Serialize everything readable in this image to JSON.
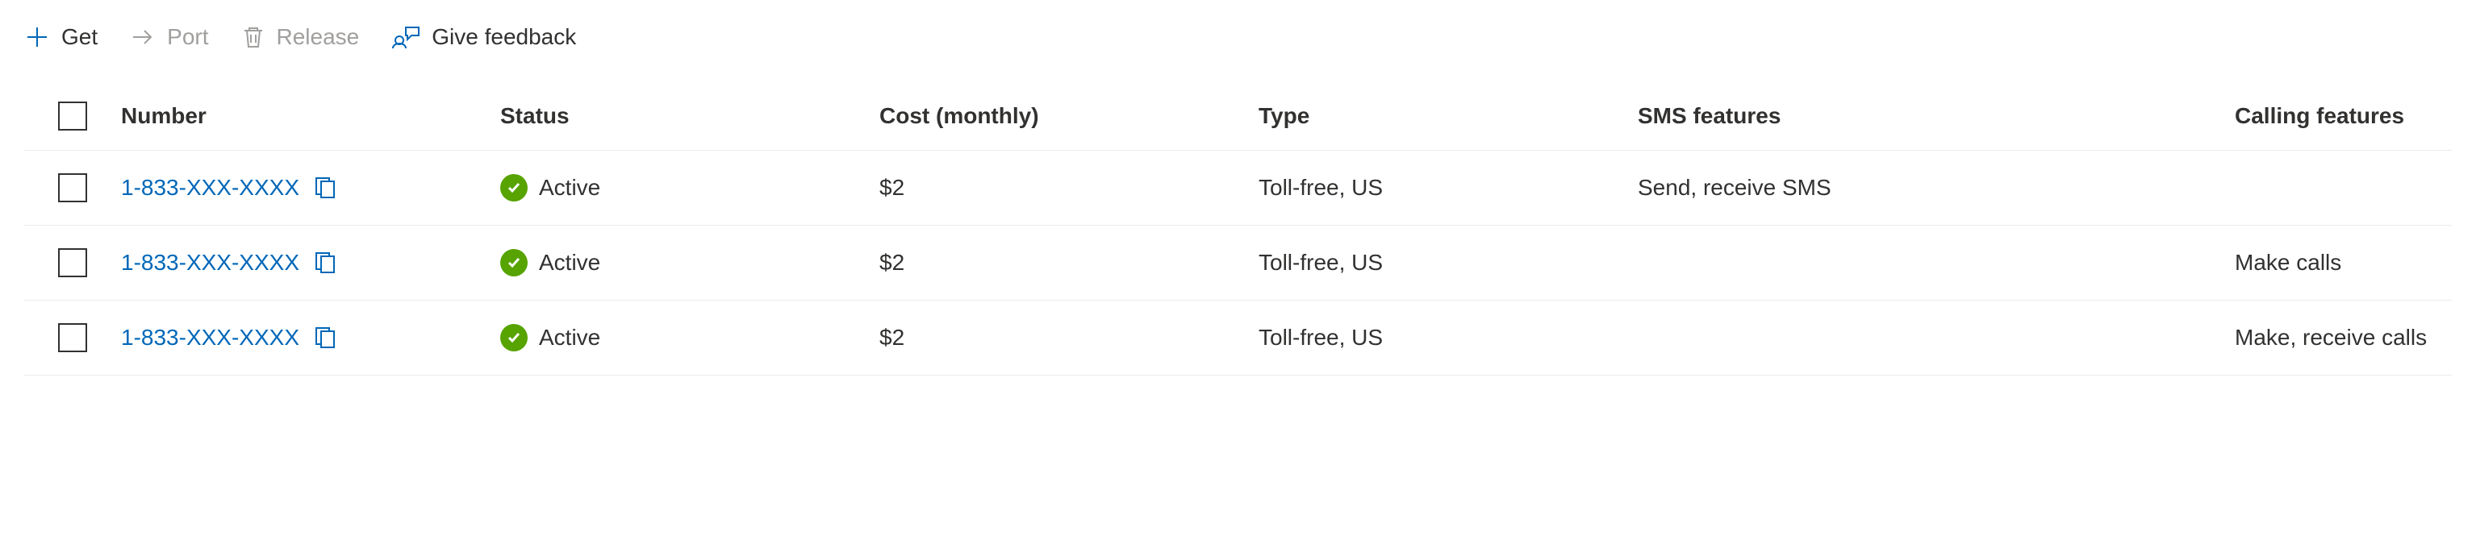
{
  "toolbar": {
    "get_label": "Get",
    "port_label": "Port",
    "release_label": "Release",
    "feedback_label": "Give feedback"
  },
  "table": {
    "headers": {
      "number": "Number",
      "status": "Status",
      "cost": "Cost (monthly)",
      "type": "Type",
      "sms": "SMS features",
      "calling": "Calling features"
    },
    "rows": [
      {
        "number": "1-833-XXX-XXXX",
        "status": "Active",
        "cost": "$2",
        "type": "Toll-free, US",
        "sms": "Send, receive SMS",
        "calling": ""
      },
      {
        "number": "1-833-XXX-XXXX",
        "status": "Active",
        "cost": "$2",
        "type": "Toll-free, US",
        "sms": "",
        "calling": "Make calls"
      },
      {
        "number": "1-833-XXX-XXXX",
        "status": "Active",
        "cost": "$2",
        "type": "Toll-free, US",
        "sms": "",
        "calling": "Make, receive calls"
      }
    ]
  }
}
